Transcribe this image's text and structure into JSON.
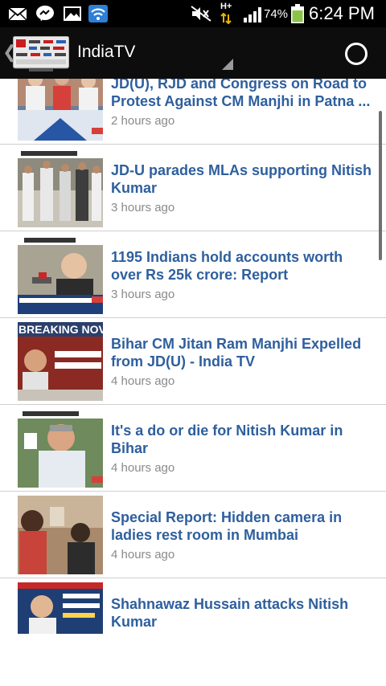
{
  "statusbar": {
    "battery_percent": "74%",
    "time": "6:24 PM",
    "network": "H+"
  },
  "actionbar": {
    "title": "IndiaTV"
  },
  "articles": [
    {
      "title": "JD(U), RJD and Congress on Road to Protest Against CM Manjhi in Patna ...",
      "time": "2 hours ago"
    },
    {
      "title": "JD-U parades MLAs supporting Nitish Kumar",
      "time": "3 hours ago"
    },
    {
      "title": "1195 Indians hold accounts worth over Rs 25k crore: Report",
      "time": "3 hours ago"
    },
    {
      "title": "Bihar CM Jitan Ram Manjhi Expelled from JD(U) - India TV",
      "time": "4 hours ago"
    },
    {
      "title": "It's a do or die for Nitish Kumar in Bihar",
      "time": "4 hours ago"
    },
    {
      "title": "Special Report: Hidden camera in ladies rest room in Mumbai",
      "time": "4 hours ago"
    },
    {
      "title": "Shahnawaz Hussain attacks Nitish Kumar",
      "time": ""
    }
  ],
  "thumbnail_overlays": {
    "breaking": "BREAKING NOV"
  },
  "colors": {
    "title_blue": "#2e5f9e",
    "time_gray": "#8a8a8a",
    "battery_green": "#8bc34a"
  },
  "icons": [
    "email-icon",
    "messenger-icon",
    "gallery-icon",
    "wifi-icon",
    "mute-icon",
    "signal-icon",
    "battery-icon",
    "back-chevron-icon",
    "app-logo",
    "refresh-icon"
  ]
}
